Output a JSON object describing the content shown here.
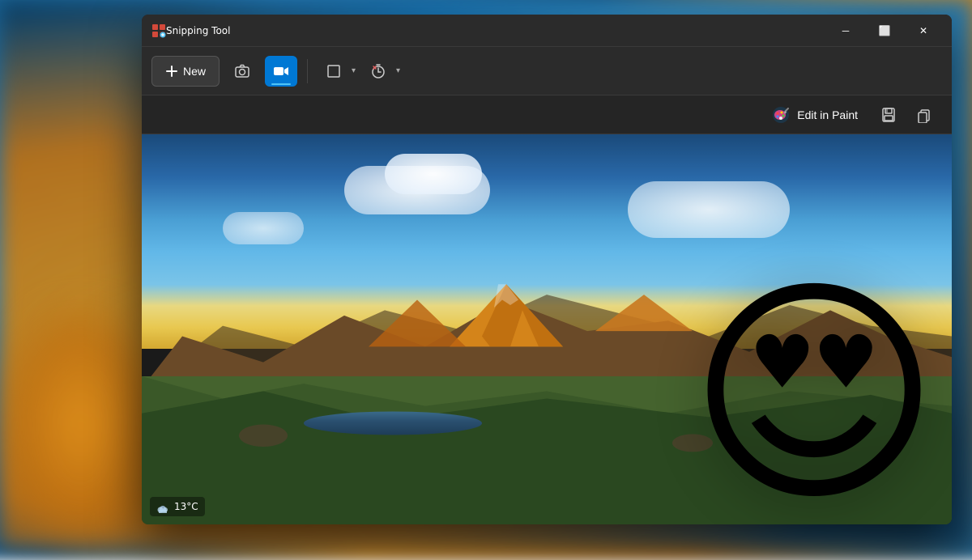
{
  "background": {
    "colors": {
      "sky_top": "#1a4a8a",
      "sky_bottom": "#4ab0e8",
      "orange_accent": "#d4921e"
    }
  },
  "window": {
    "title": "Snipping Tool",
    "title_bar": {
      "minimize_label": "─",
      "maximize_label": "⬜",
      "close_label": "✕"
    },
    "toolbar": {
      "new_button_label": "New",
      "screenshot_btn_label": "📷",
      "video_btn_label": "🎥",
      "shape_btn_label": "⬜",
      "timer_btn_label": "⏰"
    },
    "action_bar": {
      "edit_in_paint_label": "Edit in Paint",
      "save_label": "💾",
      "copy_label": "⧉"
    },
    "weather": {
      "temp": "13°C"
    }
  },
  "emoji": {
    "character": "😍",
    "description": "smiling face with heart eyes"
  }
}
